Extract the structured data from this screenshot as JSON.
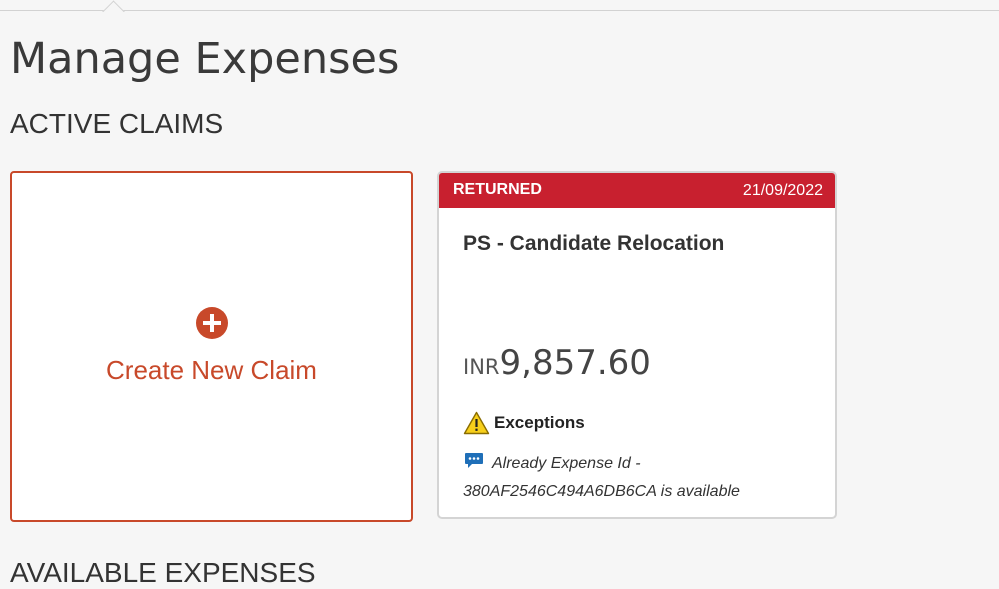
{
  "page": {
    "title": "Manage Expenses"
  },
  "sections": {
    "active_claims": "ACTIVE CLAIMS",
    "available_expenses": "AVAILABLE EXPENSES"
  },
  "create_card": {
    "label": "Create New Claim",
    "icon": "plus-circle-icon",
    "accent_color": "#c8492a"
  },
  "claim": {
    "status": "RETURNED",
    "status_color": "#c8202f",
    "date": "21/09/2022",
    "name": "PS - Candidate Relocation",
    "currency": "INR",
    "amount": "9,857.60",
    "exceptions_label": "Exceptions",
    "exceptions_icon": "warning-icon",
    "message_icon": "chat-bubble-icon",
    "message": "Already Expense Id - 380AF2546C494A6DB6CA is available"
  }
}
